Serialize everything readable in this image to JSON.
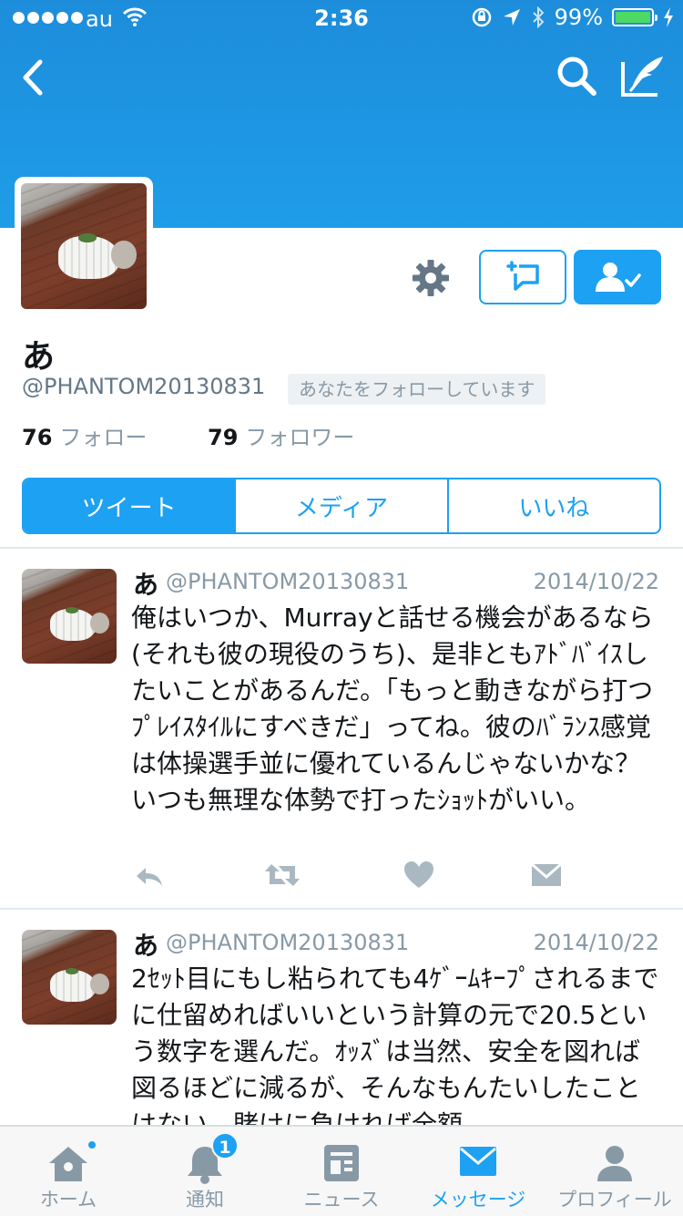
{
  "status_bar": {
    "carrier": "au",
    "time": "2:36",
    "battery": "99%",
    "battery_level": 0.99
  },
  "nav": {
    "back_icon": "chevron-left-icon",
    "search_icon": "search-icon",
    "compose_icon": "compose-icon"
  },
  "profile": {
    "display_name": "あ",
    "handle": "@PHANTOM20130831",
    "follows_you": "あなたをフォローしています",
    "following_count": "76",
    "following_label": "フォロー",
    "followers_count": "79",
    "followers_label": "フォロワー"
  },
  "tabs": [
    {
      "label": "ツイート",
      "active": true
    },
    {
      "label": "メディア",
      "active": false
    },
    {
      "label": "いいね",
      "active": false
    }
  ],
  "tweets": [
    {
      "name": "あ",
      "handle": "@PHANTOM20130831",
      "date": "2014/10/22",
      "text": "俺はいつか、Murrayと話せる機会があるなら(それも彼の現役のうち)、是非ともｱﾄﾞﾊﾞｲｽしたいことがあるんだ。「もっと動きながら打つﾌﾟﾚｲｽﾀｲﾙにすべきだ」ってね。彼のﾊﾞﾗﾝｽ感覚は体操選手並に優れているんじゃないかな？いつも無理な体勢で打ったｼｮｯﾄがいい。"
    },
    {
      "name": "あ",
      "handle": "@PHANTOM20130831",
      "date": "2014/10/22",
      "text": "2ｾｯﾄ目にもし粘られても4ｹﾞｰﾑｷｰﾌﾟされるまでに仕留めればいいという計算の元で20.5という数字を選んだ。ｵｯｽﾞは当然、安全を図れば図るほどに減るが、そんなもんたいしたことはない。賭けに負ければ全額"
    }
  ],
  "tabbar": [
    {
      "label": "ホーム",
      "icon": "home-icon",
      "active": false,
      "dot": true
    },
    {
      "label": "通知",
      "icon": "bell-icon",
      "active": false,
      "badge": "1"
    },
    {
      "label": "ニュース",
      "icon": "news-icon",
      "active": false
    },
    {
      "label": "メッセージ",
      "icon": "envelope-icon",
      "active": true
    },
    {
      "label": "プロフィール",
      "icon": "person-icon",
      "active": false
    }
  ],
  "colors": {
    "accent": "#1da1f2",
    "header": "#1f9de8",
    "muted": "#8899a6"
  }
}
